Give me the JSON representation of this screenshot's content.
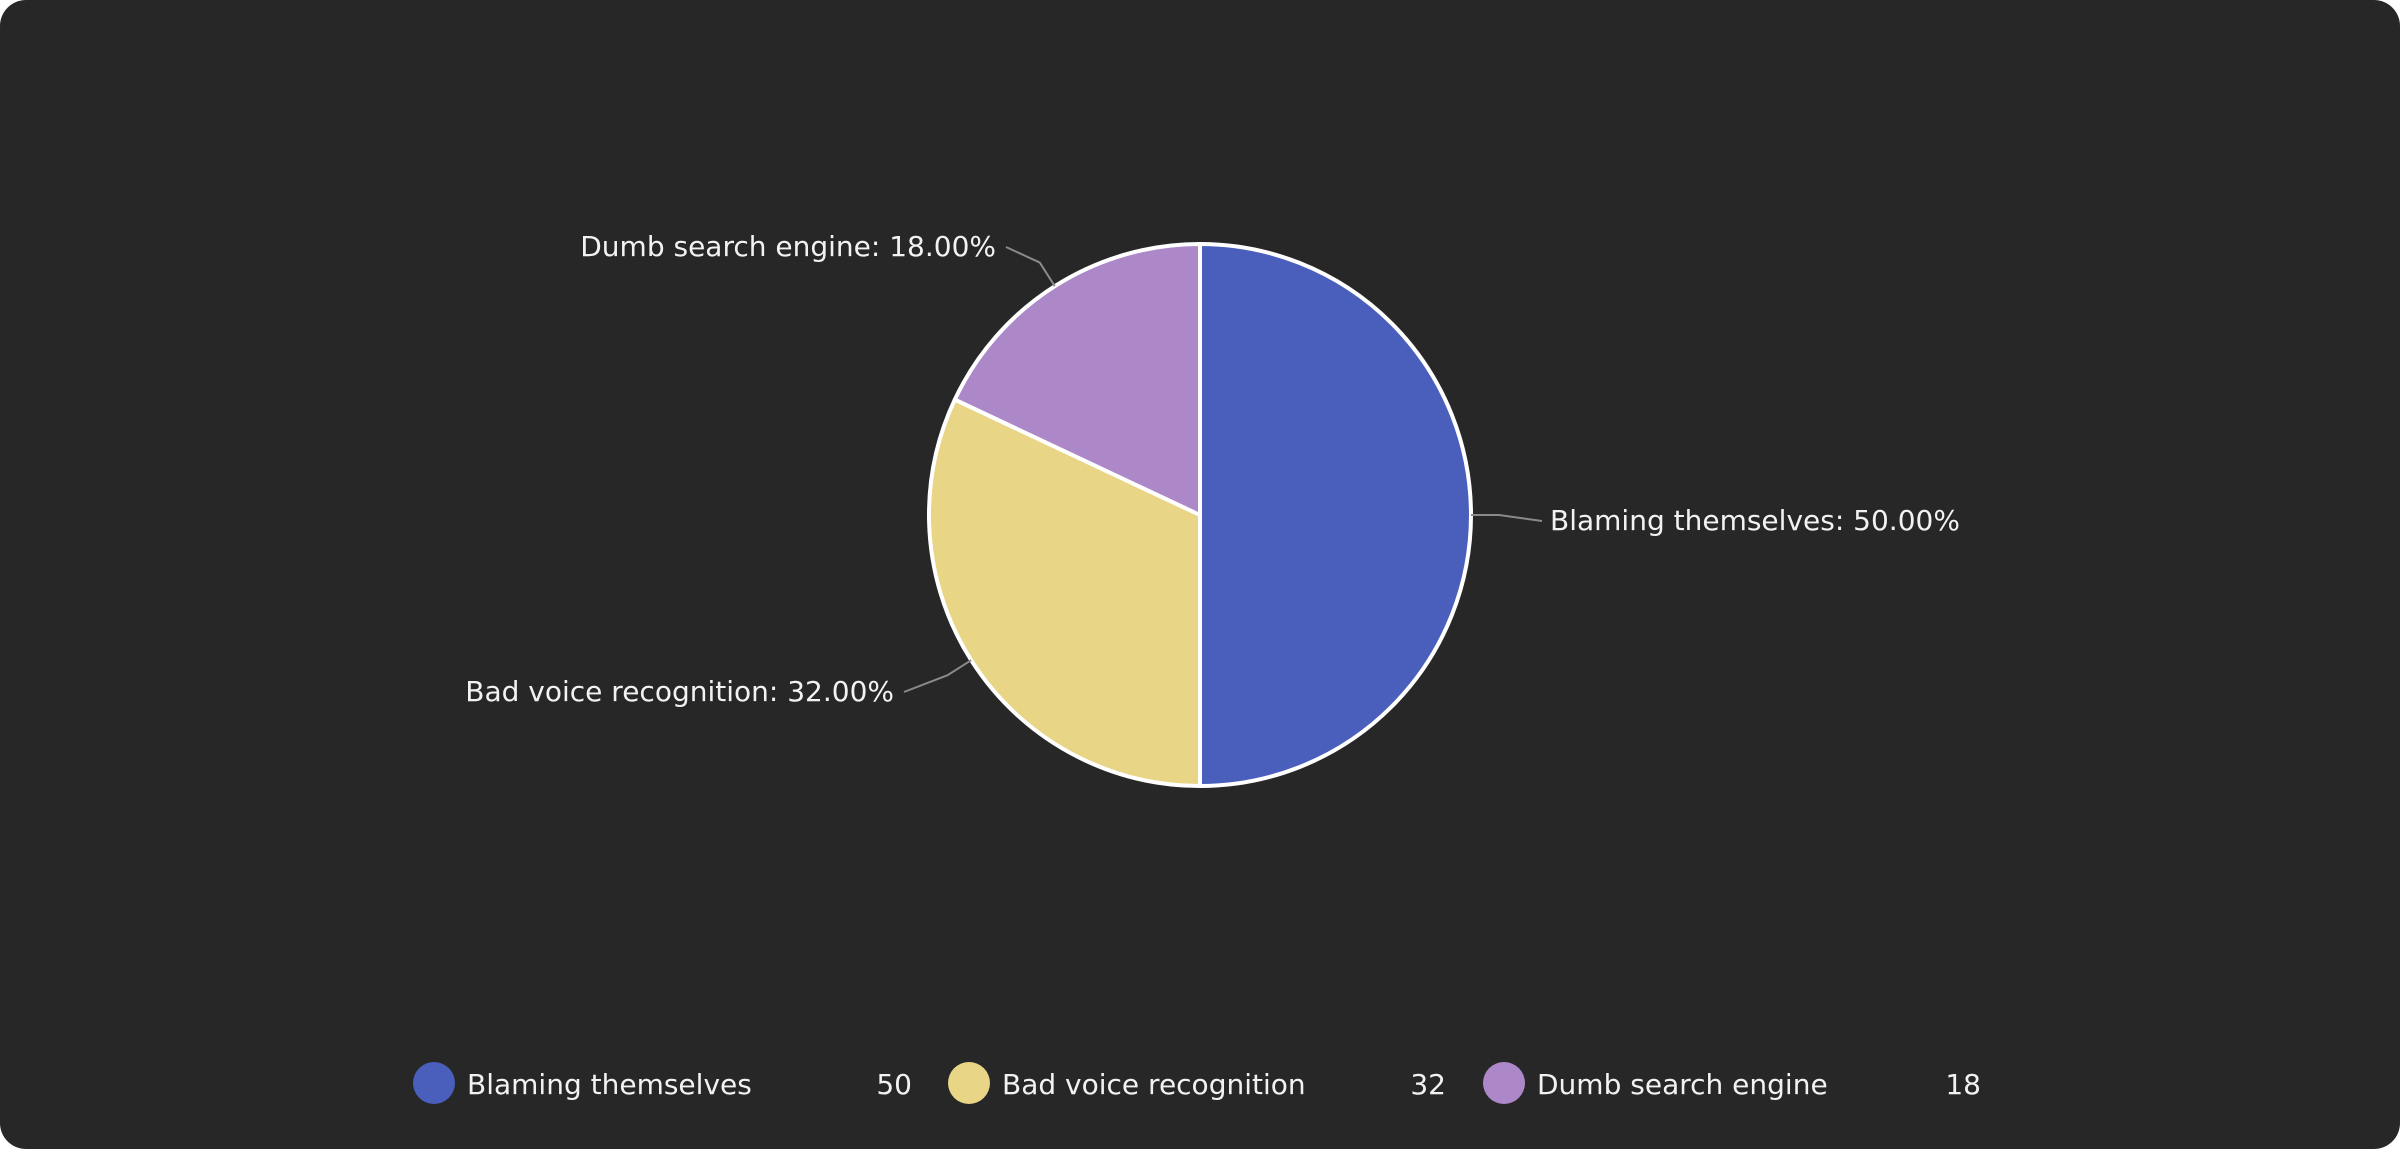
{
  "chart_data": {
    "type": "pie",
    "categories": [
      "Blaming themselves",
      "Bad voice recognition",
      "Dumb search engine"
    ],
    "values": [
      50,
      32,
      18
    ],
    "slice_labels": [
      "Blaming themselves: 50.00%",
      "Bad voice recognition: 32.00%",
      "Dumb search engine: 18.00%"
    ],
    "legend": {
      "placement": "bottom",
      "entries": [
        {
          "name": "Blaming themselves",
          "value": "50"
        },
        {
          "name": "Bad voice recognition",
          "value": "32"
        },
        {
          "name": "Dumb search engine",
          "value": "18"
        }
      ]
    },
    "colors": [
      "#4a5fbc",
      "#e8d586",
      "#ad88c8"
    ],
    "slice_border_color": "#ffffff",
    "background_color": "#272727"
  }
}
